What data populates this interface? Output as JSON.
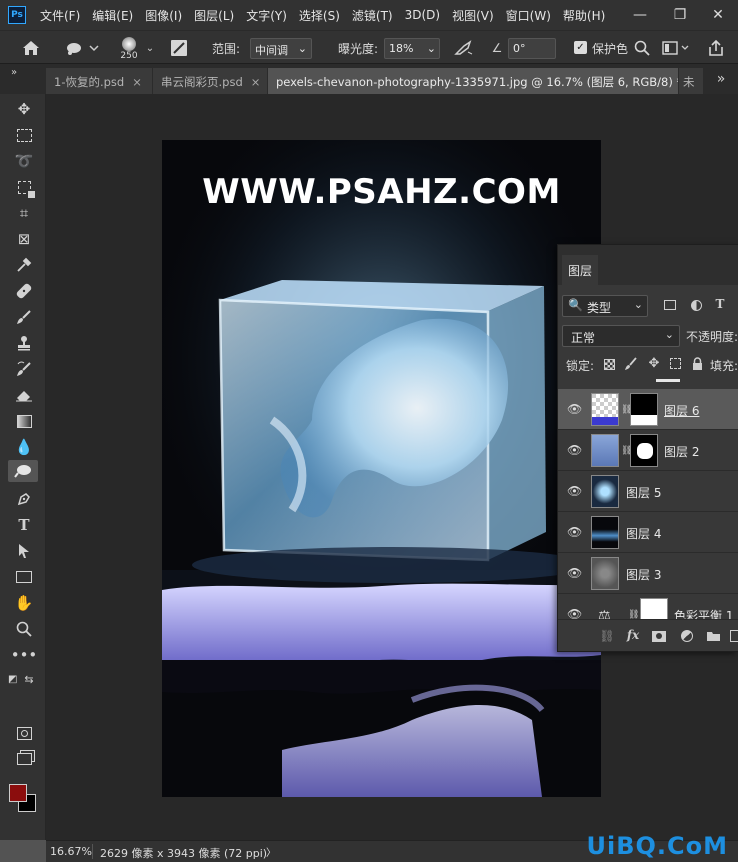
{
  "app": {
    "logo": "Ps"
  },
  "menu": [
    "文件(F)",
    "编辑(E)",
    "图像(I)",
    "图层(L)",
    "文字(Y)",
    "选择(S)",
    "滤镜(T)",
    "3D(D)",
    "视图(V)",
    "窗口(W)",
    "帮助(H)"
  ],
  "window_controls": {
    "minimize": "—",
    "maximize": "❐",
    "close": "✕"
  },
  "options": {
    "brush_size": "250",
    "range_label": "范围:",
    "range_value": "中间调",
    "exposure_label": "曝光度:",
    "exposure_value": "18%",
    "angle_value": "0°",
    "protect_tones_label": "保护色",
    "protect_tones_checked": true
  },
  "tabs": [
    {
      "label": "1-恢复的.psd",
      "close": "×",
      "active": false
    },
    {
      "label": "串云阁彩页.psd",
      "close": "×",
      "active": false
    },
    {
      "label": "pexels-chevanon-photography-1335971.jpg @ 16.7% (图层 6, RGB/8) *",
      "close": "×",
      "active": true
    }
  ],
  "tab_overflow": "»",
  "colors": {
    "foreground": "#8b0d0d",
    "background": "#000000",
    "accent": "#31a8ff"
  },
  "photo": {
    "watermark_text": "WWW.PSAHZ.COM"
  },
  "layers_panel": {
    "title": "图层",
    "filter_type": "类型",
    "blend_mode": "正常",
    "opacity_label": "不透明度:",
    "lock_label": "锁定:",
    "fill_label": "填充:",
    "layers": [
      {
        "name": "图层 6",
        "visible": true,
        "has_mask": true,
        "active": true
      },
      {
        "name": "图层 2",
        "visible": true,
        "has_mask": true,
        "active": false
      },
      {
        "name": "图层 5",
        "visible": true,
        "has_mask": false,
        "active": false
      },
      {
        "name": "图层 4",
        "visible": true,
        "has_mask": false,
        "active": false
      },
      {
        "name": "图层 3",
        "visible": true,
        "has_mask": false,
        "active": false
      },
      {
        "name": "色彩平衡 1",
        "visible": true,
        "has_mask": true,
        "active": false
      }
    ]
  },
  "status": {
    "zoom": "16.67%",
    "doc_info": "2629 像素 x 3943 像素 (72 ppi)",
    "arrow": "〉"
  },
  "site_watermark": "UiBQ.CoM"
}
